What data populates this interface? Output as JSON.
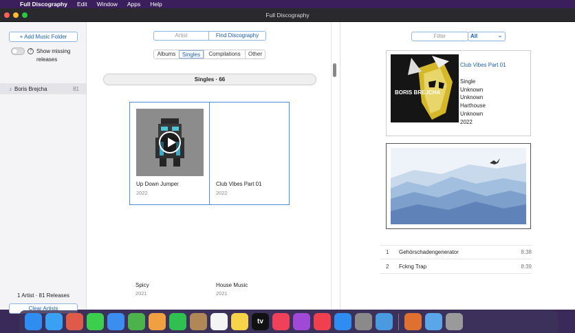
{
  "menubar": {
    "app_name": "Full Discography",
    "items": [
      "Edit",
      "Window",
      "Apps",
      "Help"
    ]
  },
  "window": {
    "title": "Full Discography"
  },
  "sidebar": {
    "add_folder_label": "+ Add Music Folder",
    "show_missing_label": "Show missing releases",
    "artists": [
      {
        "name": "Boris Brejcha",
        "count": "81"
      }
    ],
    "footer_count": "1 Artist · 81 Releases",
    "clear_label": "Clear Artists"
  },
  "center": {
    "mode_tabs": [
      "Artist",
      "Find Discography"
    ],
    "release_tabs": [
      "Albums",
      "Singles",
      "Compilations",
      "Other"
    ],
    "section_label": "Singles · 66",
    "releases": [
      {
        "title": "Up Down Jumper",
        "year": "2022"
      },
      {
        "title": "Club Vibes Part 01",
        "year": "2022"
      },
      {
        "title": "Spicy",
        "year": "2021"
      },
      {
        "title": "House Music",
        "year": "2021"
      }
    ]
  },
  "right": {
    "filter_placeholder": "Filter",
    "filter_select": "All",
    "selected": {
      "title": "Club Vibes Part 01",
      "type": "Single",
      "field2": "Unknown",
      "field3": "Unknown",
      "label": "Harthouse",
      "field5": "Unknown",
      "year": "2022",
      "cover_text": "BORIS BREJCHA"
    },
    "tracks": [
      {
        "num": "1",
        "title": "Gehörschadengenerator",
        "duration": "8:38"
      },
      {
        "num": "2",
        "title": "Fckng Trap",
        "duration": "8:39"
      }
    ]
  },
  "dock": {
    "apps": [
      {
        "name": "finder",
        "color": "#2f8cf0"
      },
      {
        "name": "safari",
        "color": "#3aa0f3"
      },
      {
        "name": "launchpad",
        "color": "#e05a4a"
      },
      {
        "name": "messages",
        "color": "#3ccf4e"
      },
      {
        "name": "mail",
        "color": "#3b8ef0"
      },
      {
        "name": "maps",
        "color": "#4cb34c"
      },
      {
        "name": "photos",
        "color": "#f0a040"
      },
      {
        "name": "facetime",
        "color": "#30c050"
      },
      {
        "name": "contacts",
        "color": "#b08858"
      },
      {
        "name": "reminders",
        "color": "#f4f4f4"
      },
      {
        "name": "notes",
        "color": "#f7d34a"
      },
      {
        "name": "tv",
        "color": "#111111"
      },
      {
        "name": "music",
        "color": "#f0405a"
      },
      {
        "name": "podcasts",
        "color": "#a048d8"
      },
      {
        "name": "news",
        "color": "#f04050"
      },
      {
        "name": "app-store",
        "color": "#2f8cf0"
      },
      {
        "name": "system-preferences",
        "color": "#8a8a8a"
      },
      {
        "name": "full-discography",
        "color": "#4a9ae0"
      },
      {
        "name": "disk-utility",
        "color": "#e07030"
      }
    ],
    "tv_label": "tv"
  }
}
